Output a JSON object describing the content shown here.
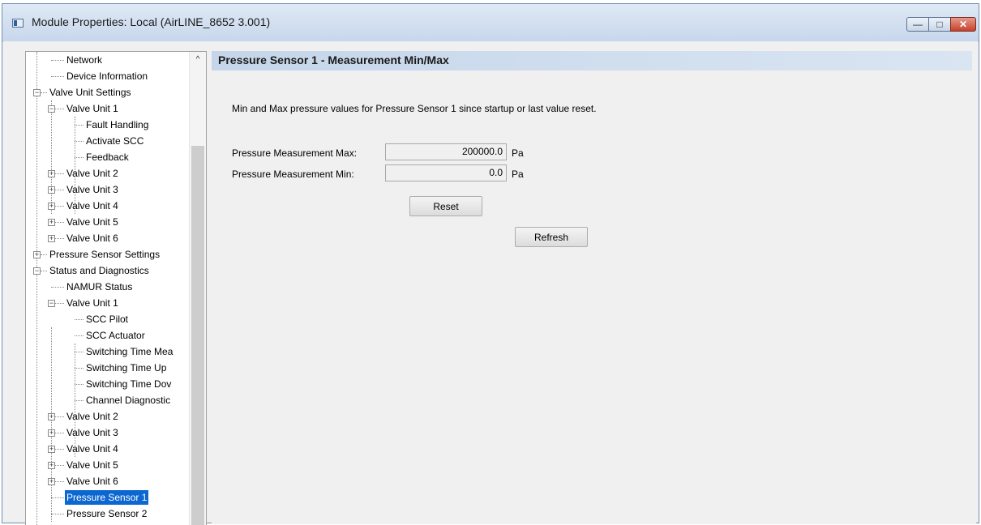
{
  "window": {
    "title": "Module Properties: Local (AirLINE_8652 3.001)",
    "controls": {
      "minimize": "—",
      "maximize": "□",
      "close": "✕"
    }
  },
  "tree": {
    "items": [
      {
        "label": "Network",
        "level": 1,
        "expander": "",
        "selected": false
      },
      {
        "label": "Device Information",
        "level": 1,
        "expander": "",
        "selected": false
      },
      {
        "label": "Valve Unit Settings",
        "level": 0,
        "expander": "−",
        "selected": false
      },
      {
        "label": "Valve Unit 1",
        "level": 1,
        "expander": "−",
        "selected": false
      },
      {
        "label": "Fault Handling",
        "level": 2,
        "expander": "",
        "selected": false
      },
      {
        "label": "Activate SCC",
        "level": 2,
        "expander": "",
        "selected": false
      },
      {
        "label": "Feedback",
        "level": 2,
        "expander": "",
        "selected": false
      },
      {
        "label": "Valve Unit 2",
        "level": 1,
        "expander": "+",
        "selected": false
      },
      {
        "label": "Valve Unit 3",
        "level": 1,
        "expander": "+",
        "selected": false
      },
      {
        "label": "Valve Unit 4",
        "level": 1,
        "expander": "+",
        "selected": false
      },
      {
        "label": "Valve Unit 5",
        "level": 1,
        "expander": "+",
        "selected": false
      },
      {
        "label": "Valve Unit 6",
        "level": 1,
        "expander": "+",
        "selected": false
      },
      {
        "label": "Pressure Sensor Settings",
        "level": 0,
        "expander": "+",
        "selected": false
      },
      {
        "label": "Status and Diagnostics",
        "level": 0,
        "expander": "−",
        "selected": false
      },
      {
        "label": "NAMUR Status",
        "level": 1,
        "expander": "",
        "selected": false
      },
      {
        "label": "Valve Unit 1",
        "level": 1,
        "expander": "−",
        "selected": false
      },
      {
        "label": "SCC Pilot",
        "level": 2,
        "expander": "",
        "selected": false
      },
      {
        "label": "SCC Actuator",
        "level": 2,
        "expander": "",
        "selected": false
      },
      {
        "label": "Switching Time Mea",
        "level": 2,
        "expander": "",
        "selected": false
      },
      {
        "label": "Switching Time Up",
        "level": 2,
        "expander": "",
        "selected": false
      },
      {
        "label": "Switching Time Dov",
        "level": 2,
        "expander": "",
        "selected": false
      },
      {
        "label": "Channel Diagnostic",
        "level": 2,
        "expander": "",
        "selected": false
      },
      {
        "label": "Valve Unit 2",
        "level": 1,
        "expander": "+",
        "selected": false
      },
      {
        "label": "Valve Unit 3",
        "level": 1,
        "expander": "+",
        "selected": false
      },
      {
        "label": "Valve Unit 4",
        "level": 1,
        "expander": "+",
        "selected": false
      },
      {
        "label": "Valve Unit 5",
        "level": 1,
        "expander": "+",
        "selected": false
      },
      {
        "label": "Valve Unit 6",
        "level": 1,
        "expander": "+",
        "selected": false
      },
      {
        "label": "Pressure Sensor 1",
        "level": 1,
        "expander": "",
        "selected": true
      },
      {
        "label": "Pressure Sensor 2",
        "level": 1,
        "expander": "",
        "selected": false
      }
    ],
    "scroll_up_glyph": "^"
  },
  "panel": {
    "title": "Pressure Sensor 1 - Measurement Min/Max",
    "description": "Min and Max pressure values for Pressure Sensor 1 since startup or last value reset.",
    "max": {
      "label": "Pressure Measurement Max:",
      "value": "200000.0",
      "unit": "Pa"
    },
    "min": {
      "label": "Pressure Measurement Min:",
      "value": "0.0",
      "unit": "Pa"
    },
    "reset_label": "Reset",
    "refresh_label": "Refresh"
  },
  "colors": {
    "selection": "#0c67d0",
    "header_band": "#c5d6ea"
  }
}
